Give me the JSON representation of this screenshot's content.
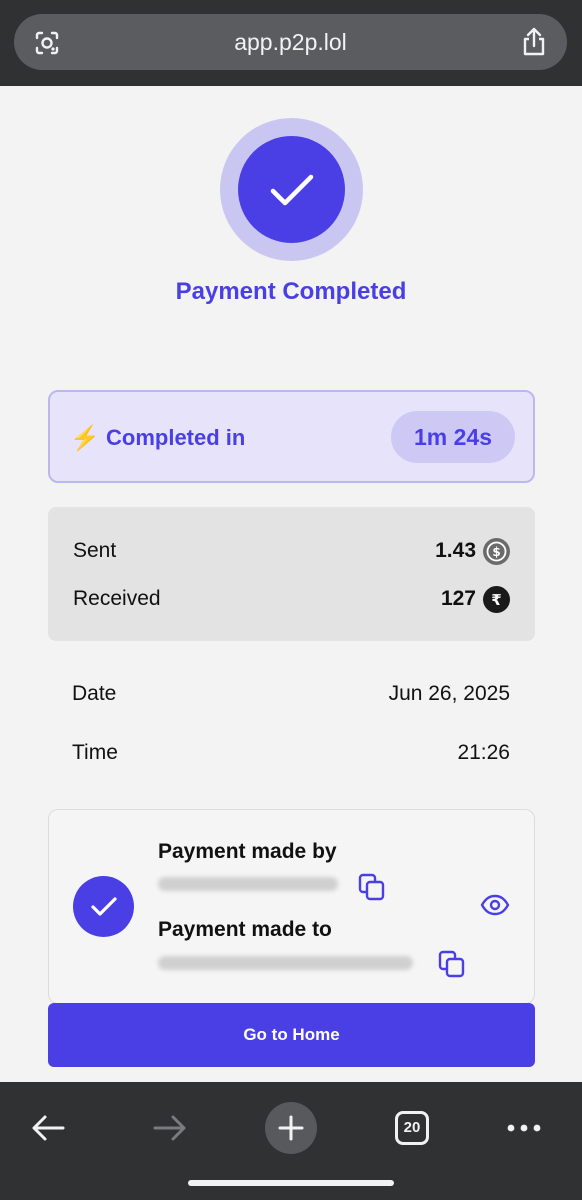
{
  "browser": {
    "url": "app.p2p.lol",
    "tab_count": "20",
    "icons": {
      "lens": "lens-icon",
      "share": "share-icon",
      "back": "back-arrow-icon",
      "forward": "forward-arrow-icon",
      "new_tab": "plus-icon",
      "tabs": "tabs-icon",
      "more": "more-icon"
    }
  },
  "status": {
    "title": "Payment Completed",
    "completed_label": "Completed in",
    "duration": "1m 24s"
  },
  "amounts": {
    "sent_label": "Sent",
    "sent_value": "1.43",
    "received_label": "Received",
    "received_value": "127"
  },
  "details": {
    "date_label": "Date",
    "date_value": "Jun 26, 2025",
    "time_label": "Time",
    "time_value": "21:26"
  },
  "party": {
    "made_by_label": "Payment made by",
    "made_to_label": "Payment made to"
  },
  "actions": {
    "home_label": "Go to Home"
  },
  "colors": {
    "accent": "#4a3fe5",
    "accent_soft": "#e6e3fb",
    "browser_chrome": "#303133",
    "bolt": "#f3b12a"
  }
}
